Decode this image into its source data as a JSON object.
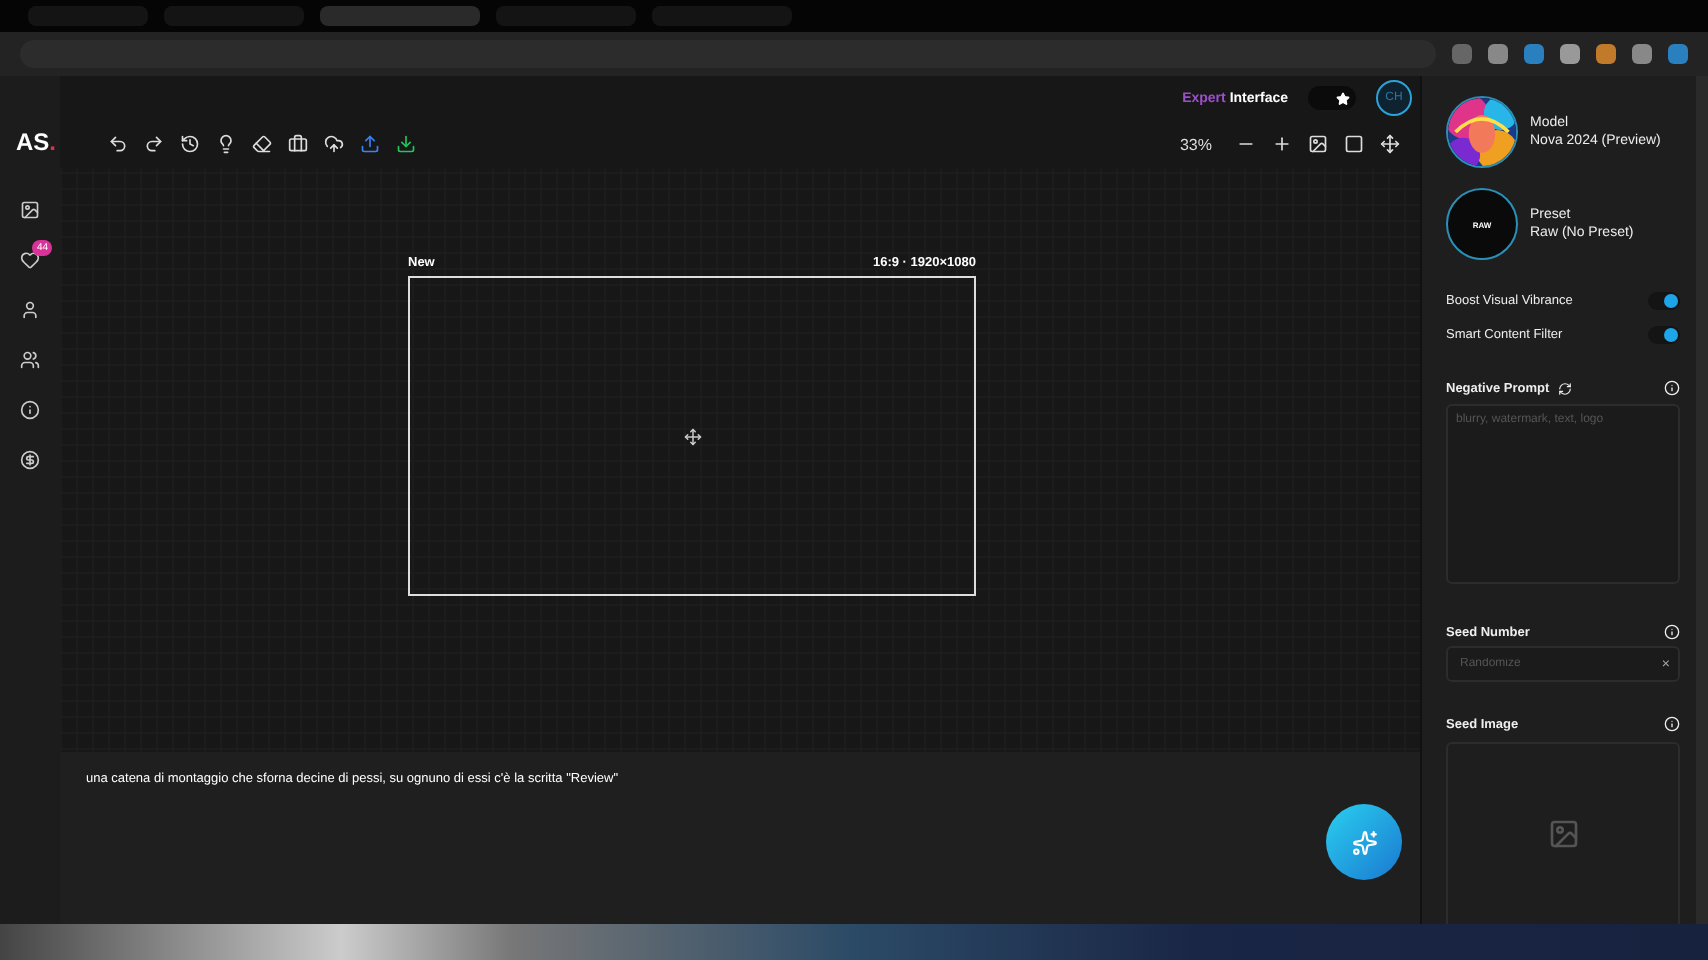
{
  "browser": {
    "tabs": [
      {
        "selected": false
      },
      {
        "selected": false
      },
      {
        "selected": true
      },
      {
        "selected": false
      },
      {
        "selected": false
      }
    ]
  },
  "header": {
    "mode_prefix": "Expert",
    "mode_label": "Interface",
    "favorite": {
      "on": true
    },
    "user_initials": "CH"
  },
  "logo": {
    "text": "AS",
    "mark": "."
  },
  "sidebar": {
    "items": [
      {
        "kind": "gallery"
      },
      {
        "kind": "favorites",
        "badge": "44"
      },
      {
        "kind": "user"
      },
      {
        "kind": "team"
      },
      {
        "kind": "info"
      },
      {
        "kind": "pricing"
      }
    ]
  },
  "toolbar": {
    "zoom": "33%"
  },
  "canvas": {
    "name": "New",
    "size": "16:9 · 1920×1080"
  },
  "prompt": {
    "text": "una catena di montaggio che sforna decine di pessi, su ognuno di essi c'è la scritta \"Review\""
  },
  "panel": {
    "model": {
      "label": "Model",
      "value": "Nova 2024 (Preview)"
    },
    "preset": {
      "label": "Preset",
      "value": "Raw (No Preset)",
      "thumb": "RAW"
    },
    "toggles": [
      {
        "label": "Boost Visual Vibrance",
        "on": true
      },
      {
        "label": "Smart Content Filter",
        "on": true
      }
    ],
    "negative_prompt": {
      "label": "Negative Prompt",
      "placeholder": "blurry, watermark, text, logo"
    },
    "seed_number": {
      "label": "Seed Number",
      "placeholder": "Randomize",
      "clear": "×"
    },
    "seed_image": {
      "label": "Seed Image"
    }
  }
}
